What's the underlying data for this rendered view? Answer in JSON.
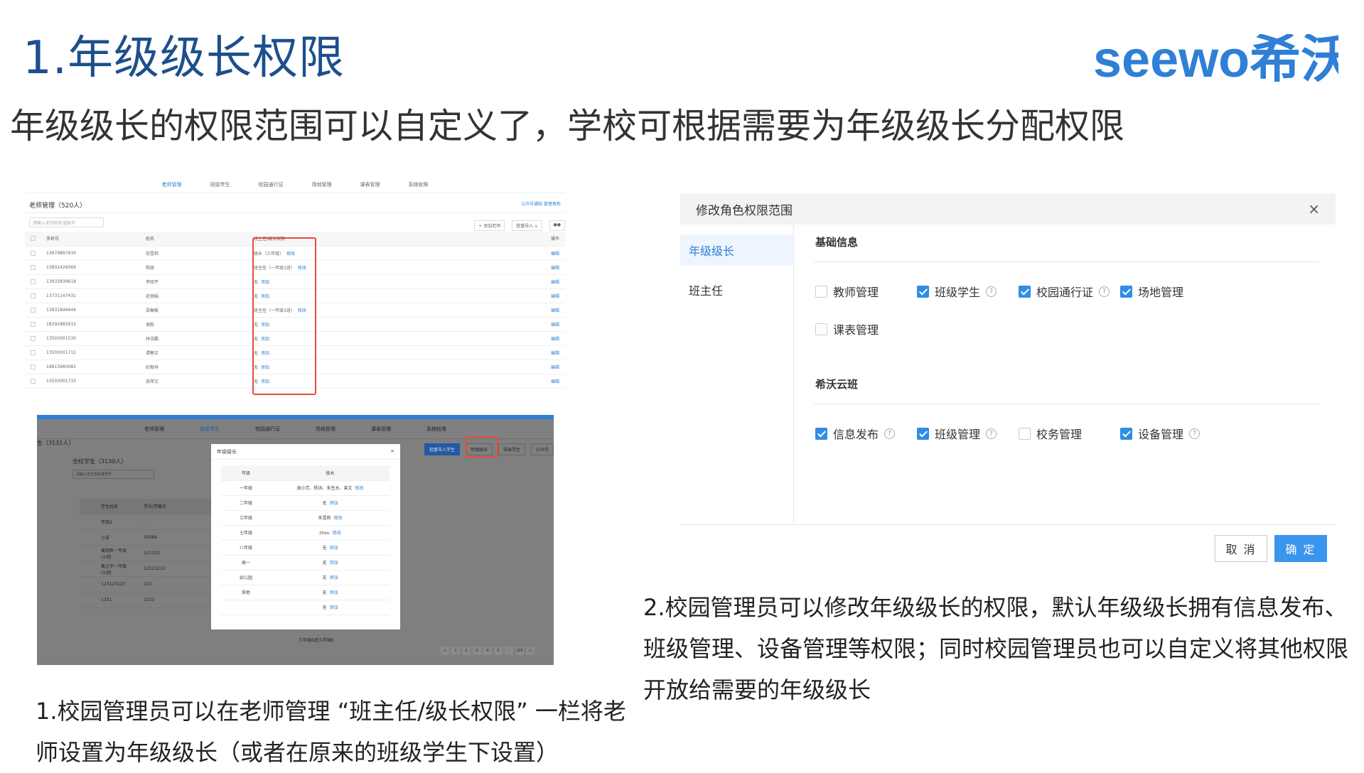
{
  "title": "1.年级级长权限",
  "logo_text": "seewo希沃",
  "subtitle": "年级级长的权限范围可以自定义了，学校可根据需要为年级级长分配权限",
  "colors": {
    "title": "#1d4f8c",
    "accent": "#2f7fd6",
    "highlight": "#e84b3a"
  },
  "ss1": {
    "nav": [
      "老师管理",
      "班级学生",
      "校园通行证",
      "场地管理",
      "课表管理",
      "系统权限"
    ],
    "header": "老师管理（520人）",
    "header_links": "公众号通知    管理角色",
    "search_placeholder": "请输入老师姓名或账号",
    "buttons": [
      "+ 添加老师",
      "批量导入 ∨",
      "●●"
    ],
    "columns": [
      "手机号",
      "姓名",
      "班主任/级长权限",
      "操作"
    ],
    "rows": [
      {
        "phone": "13679897930",
        "name": "张雪莉",
        "role": "级长（三年级）",
        "link": "修改",
        "op": "编辑"
      },
      {
        "phone": "13802426069",
        "name": "杨斌",
        "role": "班主任（一年级1班）",
        "link": "修改",
        "op": "编辑"
      },
      {
        "phone": "13933839618",
        "name": "李晓平",
        "role": "无",
        "link": "添加",
        "op": "编辑"
      },
      {
        "phone": "13731147431",
        "name": "史丽娟",
        "role": "无",
        "link": "添加",
        "op": "编辑"
      },
      {
        "phone": "13931846644",
        "name": "梁秦敏",
        "role": "班主任（一年级1班）",
        "link": "修改",
        "op": "编辑"
      },
      {
        "phone": "18292882612",
        "name": "谢毅",
        "role": "无",
        "link": "添加",
        "op": "编辑"
      },
      {
        "phone": "13503001530",
        "name": "林浩鹏",
        "role": "无",
        "link": "添加",
        "op": "编辑"
      },
      {
        "phone": "13503001712",
        "name": "谭春文",
        "role": "无",
        "link": "添加",
        "op": "编辑"
      },
      {
        "phone": "18813960081",
        "name": "纪宥祥",
        "role": "无",
        "link": "添加",
        "op": "编辑"
      },
      {
        "phone": "13503001733",
        "name": "张萍文",
        "role": "无",
        "link": "添加",
        "op": "编辑"
      }
    ]
  },
  "ss2": {
    "nav": [
      "老师管理",
      "班级学生",
      "校园通行证",
      "场地管理",
      "课表管理",
      "系统权限"
    ],
    "left_label": "生（3131人）",
    "inner_title": "全校学生（3130人）",
    "inner_search": "请输入学生姓名或学号",
    "buttons": [
      "批量导入学生",
      "年级级长",
      "导出学生",
      "公众号"
    ],
    "col1": "学生姓名",
    "col2": "学号/学籍号",
    "rows": [
      [
        "李强2",
        "-"
      ],
      [
        "小张",
        "10086"
      ],
      [
        "黄晓新一年级(1)班",
        "121212"
      ],
      [
        "黄之宇一年级(1)班",
        "12121212"
      ],
      [
        "123123123",
        "123"
      ],
      [
        "1231",
        "1231"
      ]
    ],
    "footer": "三年级6班三年级6",
    "pages": [
      "<",
      "1",
      "2",
      "3",
      "4",
      "5",
      "···",
      "105",
      ">"
    ],
    "modal": {
      "title": "年级级长",
      "close": "×",
      "columns": [
        "年级",
        "级长"
      ],
      "rows": [
        {
          "grade": "一年级",
          "value": "周小芳、杨洪、朱生水、曾文",
          "link": "修改"
        },
        {
          "grade": "二年级",
          "value": "无",
          "link": "添加"
        },
        {
          "grade": "三年级",
          "value": "朱雪莉",
          "link": "修改"
        },
        {
          "grade": "七年级",
          "value": "zhou",
          "link": "修改"
        },
        {
          "grade": "八年级",
          "value": "无",
          "link": "添加"
        },
        {
          "grade": "高一",
          "value": "无",
          "link": "添加"
        },
        {
          "grade": "幼儿园",
          "value": "无",
          "link": "添加"
        },
        {
          "grade": "其他",
          "value": "无",
          "link": "添加"
        },
        {
          "grade": "",
          "value": "无",
          "link": "添加"
        }
      ]
    }
  },
  "dialog": {
    "title": "修改角色权限范围",
    "close": "×",
    "roles": [
      "年级级长",
      "班主任"
    ],
    "section1": "基础信息",
    "basic": [
      {
        "label": "教师管理",
        "checked": false,
        "help": false
      },
      {
        "label": "班级学生",
        "checked": true,
        "help": true
      },
      {
        "label": "校园通行证",
        "checked": true,
        "help": true
      },
      {
        "label": "场地管理",
        "checked": true,
        "help": false
      },
      {
        "label": "课表管理",
        "checked": false,
        "help": false
      }
    ],
    "section2": "希沃云班",
    "cloud": [
      {
        "label": "信息发布",
        "checked": true,
        "help": true
      },
      {
        "label": "班级管理",
        "checked": true,
        "help": true
      },
      {
        "label": "校务管理",
        "checked": false,
        "help": false
      },
      {
        "label": "设备管理",
        "checked": true,
        "help": true
      }
    ],
    "cancel": "取 消",
    "ok": "确 定"
  },
  "caption1": "1.校园管理员可以在老师管理 “班主任/级长权限” 一栏将老师设置为年级级长（或者在原来的班级学生下设置）",
  "caption2": "2.校园管理员可以修改年级级长的权限，默认年级级长拥有信息发布、班级管理、设备管理等权限；同时校园管理员也可以自定义将其他权限开放给需要的年级级长"
}
